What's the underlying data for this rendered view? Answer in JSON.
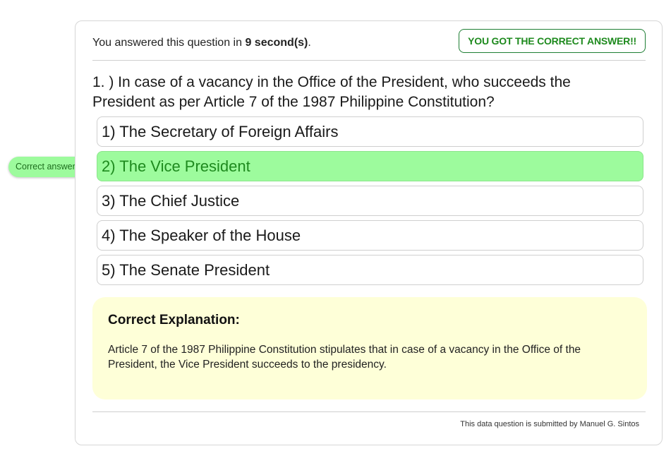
{
  "header": {
    "time_prefix": "You answered this question in ",
    "time_value": "9 second(s)",
    "time_suffix": ".",
    "result_badge": "YOU GOT THE CORRECT ANSWER!!"
  },
  "question": {
    "text": "1. ) In case of a vacancy in the Office of the President, who succeeds the President as per Article 7 of the 1987 Philippine Constitution?"
  },
  "options": [
    {
      "label": "1) The Secretary of Foreign Affairs",
      "correct": false
    },
    {
      "label": "2) The Vice President",
      "correct": true
    },
    {
      "label": "3) The Chief Justice",
      "correct": false
    },
    {
      "label": "4) The Speaker of the House",
      "correct": false
    },
    {
      "label": "5) The Senate President",
      "correct": false
    }
  ],
  "tooltip": {
    "text": "Correct answer."
  },
  "explanation": {
    "title": "Correct Explanation:",
    "text": "Article 7 of the 1987 Philippine Constitution stipulates that in case of a vacancy in the Office of the President, the Vice President succeeds to the presidency."
  },
  "footer": {
    "submitted_by": "This data question is submitted by Manuel G. Sintos"
  },
  "colors": {
    "correct_bg": "#9dfb9d",
    "correct_text": "#1e8a1e",
    "explanation_bg": "#feffd8"
  }
}
